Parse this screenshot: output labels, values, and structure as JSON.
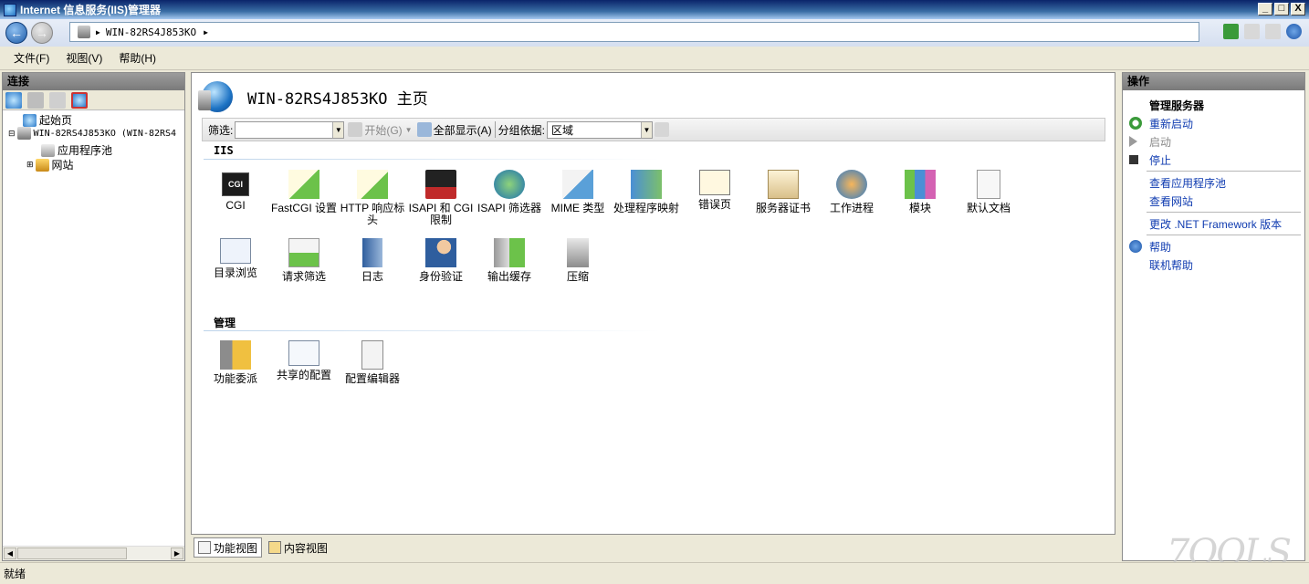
{
  "window": {
    "title": "Internet 信息服务(IIS)管理器",
    "buttons": {
      "minimize": "_",
      "maximize": "□",
      "close": "X"
    }
  },
  "address": {
    "path": "WIN-82RS4J853KO",
    "arrow1": "▶",
    "arrow2": "▶"
  },
  "menu": {
    "items": [
      "文件(F)",
      "视图(V)",
      "帮助(H)"
    ]
  },
  "connections": {
    "header": "连接",
    "tree": {
      "start_page": "起始页",
      "server": "WIN-82RS4J853KO (WIN-82RS4",
      "app_pools": "应用程序池",
      "sites": "网站",
      "expand_server": "⊟",
      "expand_sites": "⊞"
    }
  },
  "home": {
    "title": "WIN-82RS4J853KO 主页"
  },
  "filter": {
    "label": "筛选:",
    "start_label": "开始(G)",
    "show_all_label": "全部显示(A)",
    "group_by_label": "分组依据:",
    "group_by_value": "区域",
    "dropdown_arrow": "▼"
  },
  "groups": {
    "iis": {
      "title": "IIS",
      "items": [
        {
          "label": "CGI",
          "icon": "cgi-icon"
        },
        {
          "label": "FastCGI 设置",
          "icon": "fastcgi-settings-icon"
        },
        {
          "label": "HTTP 响应标头",
          "icon": "http-response-headers-icon"
        },
        {
          "label": "ISAPI 和 CGI 限制",
          "icon": "isapi-cgi-restrictions-icon"
        },
        {
          "label": "ISAPI 筛选器",
          "icon": "isapi-filters-icon"
        },
        {
          "label": "MIME 类型",
          "icon": "mime-types-icon"
        },
        {
          "label": "处理程序映射",
          "icon": "handler-mappings-icon"
        },
        {
          "label": "错误页",
          "icon": "error-pages-icon"
        },
        {
          "label": "服务器证书",
          "icon": "server-certificates-icon"
        },
        {
          "label": "工作进程",
          "icon": "worker-processes-icon"
        },
        {
          "label": "模块",
          "icon": "modules-icon"
        },
        {
          "label": "默认文档",
          "icon": "default-document-icon"
        },
        {
          "label": "目录浏览",
          "icon": "directory-browsing-icon"
        },
        {
          "label": "请求筛选",
          "icon": "request-filtering-icon"
        },
        {
          "label": "日志",
          "icon": "logging-icon"
        },
        {
          "label": "身份验证",
          "icon": "authentication-icon"
        },
        {
          "label": "输出缓存",
          "icon": "output-caching-icon"
        },
        {
          "label": "压缩",
          "icon": "compression-icon"
        }
      ]
    },
    "management": {
      "title": "管理",
      "items": [
        {
          "label": "功能委派",
          "icon": "feature-delegation-icon"
        },
        {
          "label": "共享的配置",
          "icon": "shared-configuration-icon"
        },
        {
          "label": "配置编辑器",
          "icon": "configuration-editor-icon"
        }
      ]
    }
  },
  "views": {
    "features": "功能视图",
    "content": "内容视图"
  },
  "actions": {
    "header": "操作",
    "manage_server": "管理服务器",
    "restart": "重新启动",
    "start": "启动",
    "stop": "停止",
    "view_app_pools": "查看应用程序池",
    "view_sites": "查看网站",
    "change_net": "更改 .NET Framework 版本",
    "help": "帮助",
    "online_help": "联机帮助"
  },
  "status": {
    "text": "就绪"
  },
  "watermark": "7OOLS",
  "colors": {
    "title_bar": "#0a246a",
    "link": "#0f3bb0",
    "disabled": "#8a8a8a",
    "panel_header": "#8a8a8a"
  }
}
